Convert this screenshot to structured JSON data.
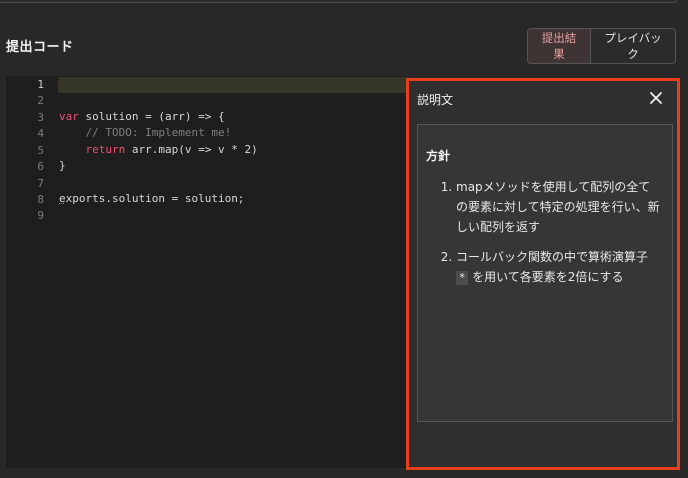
{
  "section": {
    "title": "提出コード"
  },
  "tabs": {
    "result_label": "提出結果",
    "playback_label": "プレイバック"
  },
  "editor": {
    "line_numbers": [
      "1",
      "2",
      "3",
      "4",
      "5",
      "6",
      "7",
      "8",
      "9"
    ],
    "lines": {
      "l3": {
        "kw": "var",
        "rest": " solution = (arr) => {"
      },
      "l4": {
        "comment": "// TODO: Implement me!"
      },
      "l5": {
        "kw": "return",
        "rest": " arr.map(v => v * 2)"
      },
      "l6": {
        "text": "}"
      },
      "l8": {
        "dotted": "e",
        "rest": "xports.solution = solution;"
      }
    }
  },
  "description": {
    "title": "説明文",
    "heading": "方針",
    "items": {
      "i1": "mapメソッドを使用して配列の全ての要素に対して特定の処理を行い、新しい配列を返す",
      "i2_before": "コールバック関数の中で算術演算子",
      "i2_code": "*",
      "i2_after": " を用いて各要素を2倍にする"
    }
  },
  "icons": {
    "close": "close-icon"
  }
}
